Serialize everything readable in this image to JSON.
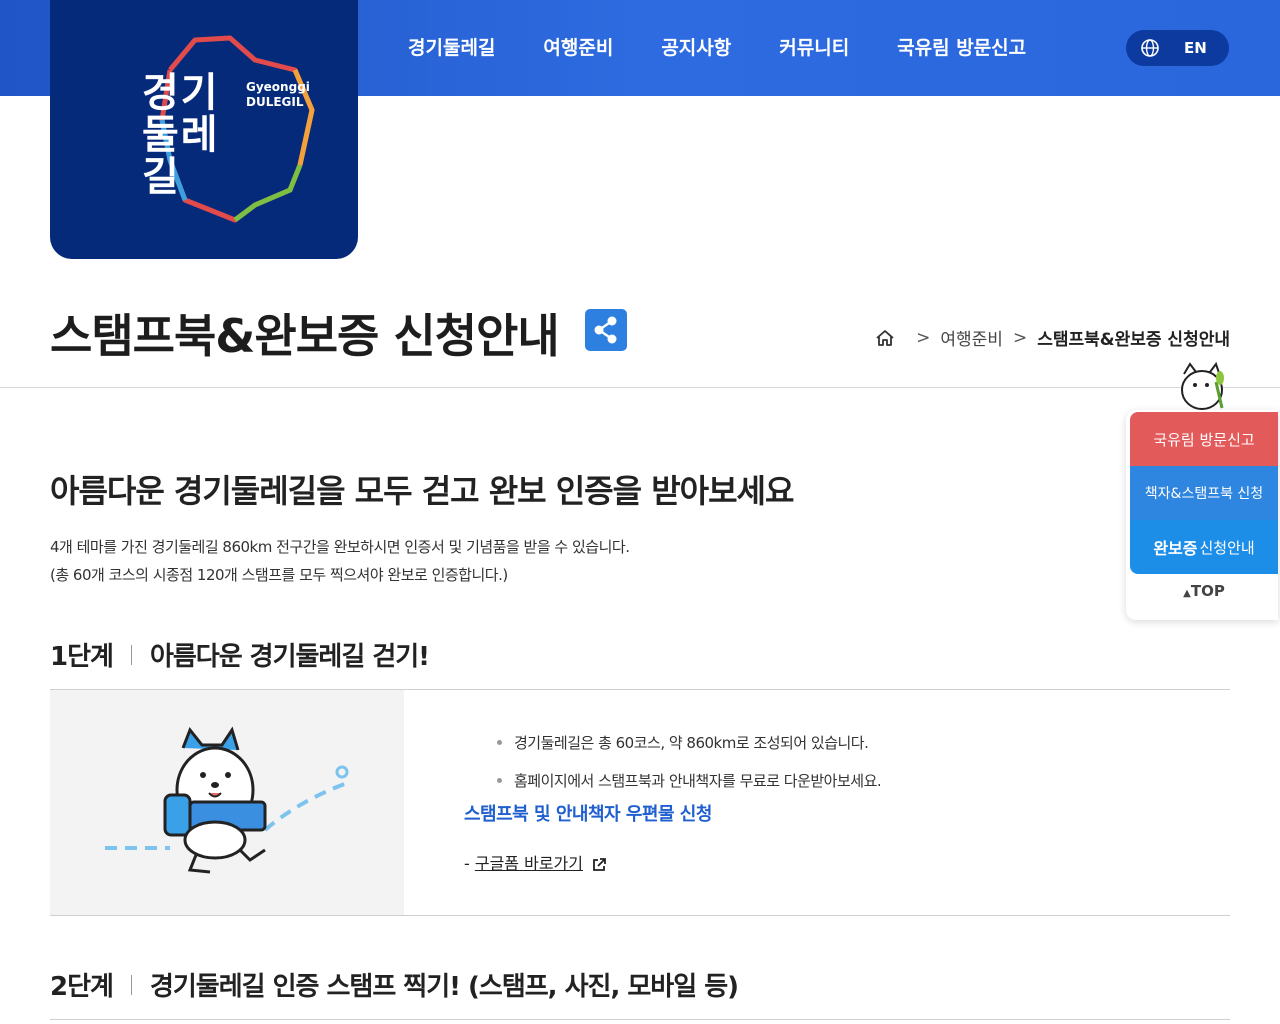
{
  "logo": {
    "korean": "경기둘레길",
    "english_line1": "Gyeonggi",
    "english_line2": "DULEGIL"
  },
  "nav": {
    "items": [
      "경기둘레길",
      "여행준비",
      "공지사항",
      "커뮤니티",
      "국유림 방문신고"
    ],
    "lang_label": "EN",
    "lang_icon": "globe-icon"
  },
  "page": {
    "title": "스탬프북&완보증 신청안내",
    "share_icon": "share-icon",
    "breadcrumb": {
      "home_icon": "home-icon",
      "sep": ">",
      "level1": "여행준비",
      "current": "스탬프북&완보증 신청안내"
    }
  },
  "intro": {
    "headline": "아름다운 경기둘레길을 모두 걷고 완보 인증을 받아보세요",
    "line1": "4개 테마를 가진 경기둘레길 860km 전구간을 완보하시면 인증서 및 기념품을 받을 수 있습니다.",
    "line2": "(총 60개 코스의 시종점 120개 스탬프를 모두 찍으셔야 완보로 인증합니다.)"
  },
  "step1": {
    "label": "1단계",
    "title": "아름다운 경기둘레길 걷기!",
    "bullets": [
      "경기둘레길은 총 60코스, 약 860km로 조성되어 있습니다.",
      "홈페이지에서 스탬프북과 안내책자를 무료로 다운받아보세요."
    ],
    "link_title": "스탬프북 및 안내책자 우편물 신청",
    "link_prefix": "- ",
    "link_text": "구글폼 바로가기"
  },
  "step2": {
    "label": "2단계",
    "title": "경기둘레길 인증 스탬프 찍기! (스탬프, 사진, 모바일 등)"
  },
  "quick_menu": {
    "item1": "국유림 방문신고",
    "item2": "책자&스탬프북 신청",
    "item3_bold": "완보증",
    "item3_rest": "신청안내",
    "top_label": "TOP"
  },
  "colors": {
    "header_blue": "#2a62d8",
    "logo_navy": "#062a7a",
    "link_blue": "#1f5fcf",
    "quick_red": "#e25a5a",
    "quick_blue": "#2f86e0"
  }
}
